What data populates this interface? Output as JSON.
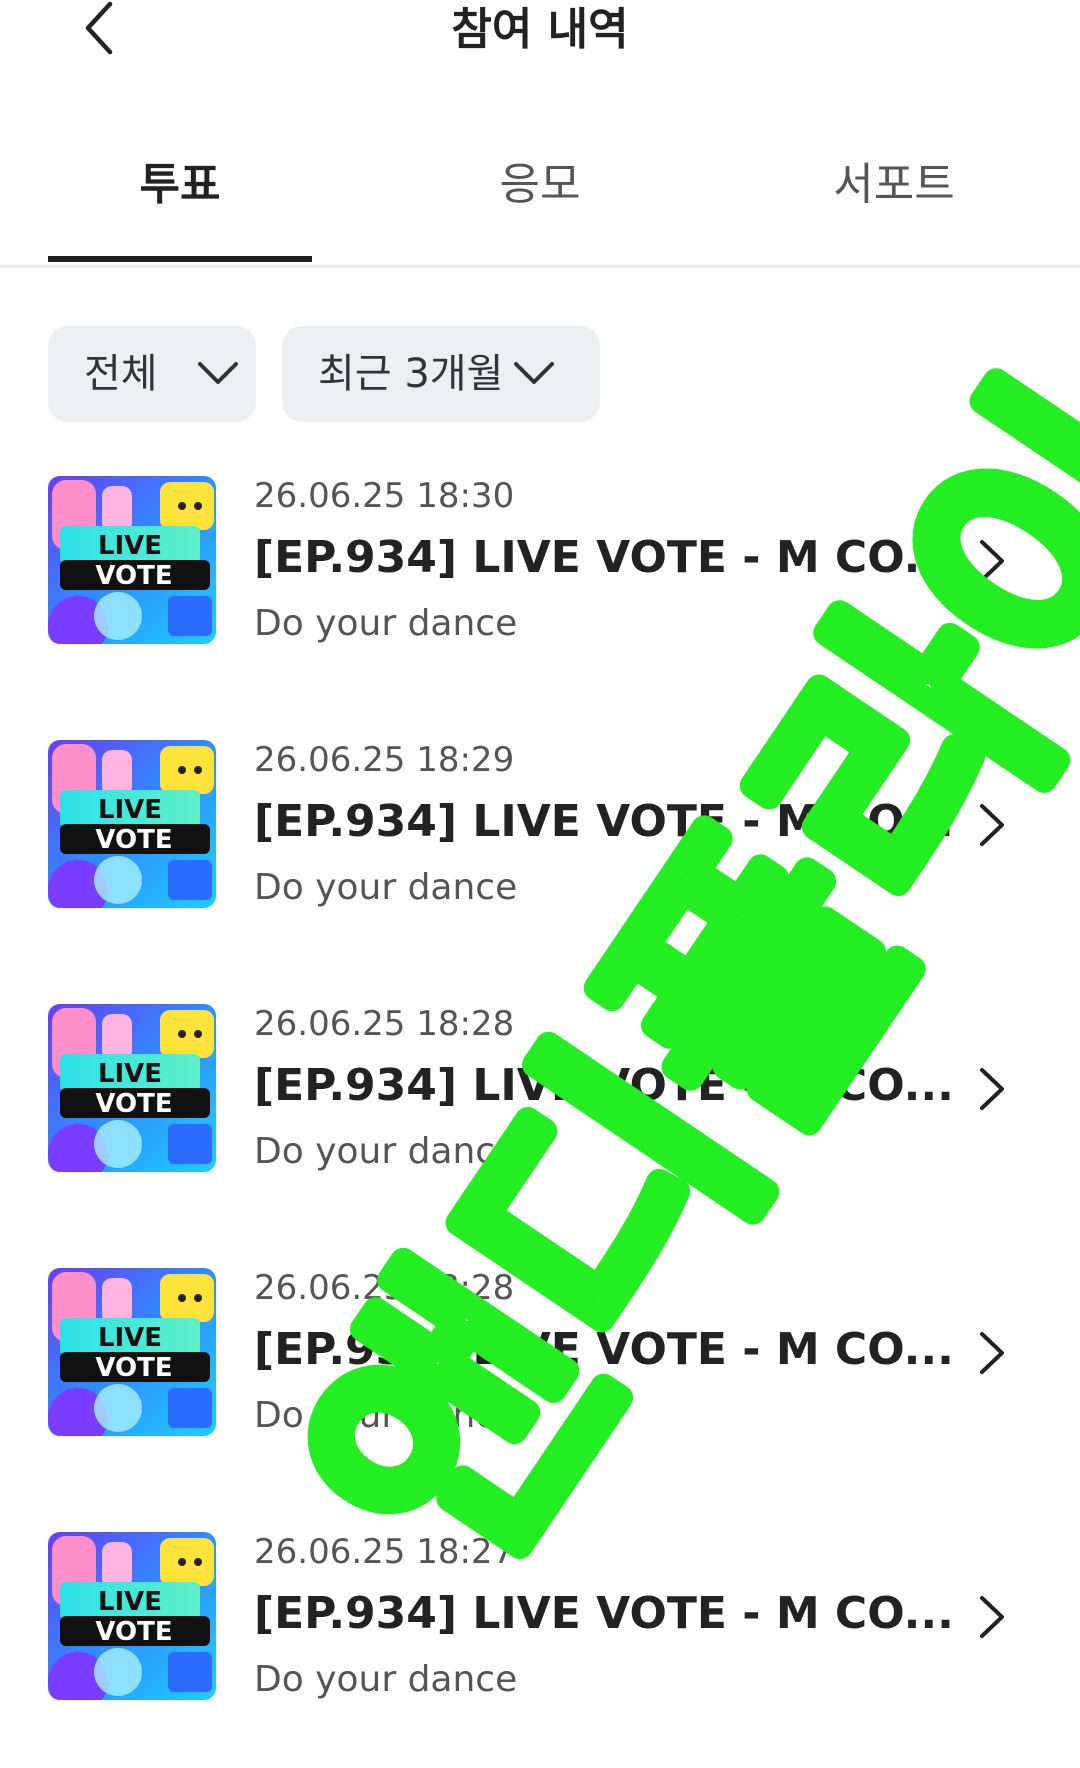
{
  "header": {
    "title": "참여 내역",
    "back_icon": "chevron-left-icon"
  },
  "tabs": [
    {
      "label": "투표",
      "active": true
    },
    {
      "label": "응모",
      "active": false
    },
    {
      "label": "서포트",
      "active": false
    }
  ],
  "filters": [
    {
      "label": "전체",
      "icon": "chevron-down-icon"
    },
    {
      "label": "최근 3개월",
      "icon": "chevron-down-icon"
    }
  ],
  "items": [
    {
      "date": "26.06.25 18:30",
      "title": "[EP.934] LIVE VOTE - M CO...",
      "subtitle": "Do your dance",
      "thumb_line1": "LIVE",
      "thumb_line2": "VOTE"
    },
    {
      "date": "26.06.25 18:29",
      "title": "[EP.934] LIVE VOTE - M CO...",
      "subtitle": "Do your dance",
      "thumb_line1": "LIVE",
      "thumb_line2": "VOTE"
    },
    {
      "date": "26.06.25 18:28",
      "title": "[EP.934] LIVE VOTE - M CO...",
      "subtitle": "Do your dance",
      "thumb_line1": "LIVE",
      "thumb_line2": "VOTE"
    },
    {
      "date": "26.06.25 18:28",
      "title": "[EP.934] LIVE VOTE - M CO...",
      "subtitle": "Do your dance",
      "thumb_line1": "LIVE",
      "thumb_line2": "VOTE"
    },
    {
      "date": "26.06.25 18:27",
      "title": "[EP.934] LIVE VOTE - M CO...",
      "subtitle": "Do your dance",
      "thumb_line1": "LIVE",
      "thumb_line2": "VOTE"
    }
  ],
  "watermark": {
    "text": "앤디플라이",
    "color": "#22ee22"
  },
  "colors": {
    "text_primary": "#222222",
    "text_secondary": "#555555",
    "filter_bg": "#eceef1",
    "divider": "#ececec"
  }
}
